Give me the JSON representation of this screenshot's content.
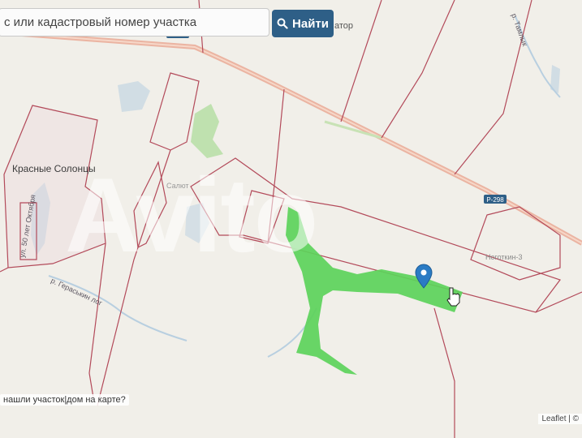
{
  "search": {
    "placeholder": "с или кадастровый номер участка",
    "button_label": "Найти",
    "button_icon": "search-icon",
    "button_color": "#2e5f87",
    "partial_label": "атор"
  },
  "map": {
    "places": {
      "village": "Красные Солонцы",
      "river_1": "р. Гераськин лог",
      "river_2": "р. Тамлык",
      "street": "ул. 50 лет Октября",
      "hamlet": "Салют",
      "hamlet_2": "Ноготкин-3"
    },
    "roads": {
      "r1": "Р-298",
      "r2": "Р-298"
    },
    "marker_icon": "map-pin-icon",
    "cursor_icon": "hand-cursor-icon",
    "colors": {
      "parcel_border": "#b34a5a",
      "selected_parcel": "#5cd35a",
      "road": "#e8a08a",
      "marker": "#2b7bc4"
    }
  },
  "footer": {
    "hint": "нашли участок|дом на карте?",
    "attribution": "Leaflet | ©"
  },
  "watermark": "Avito"
}
